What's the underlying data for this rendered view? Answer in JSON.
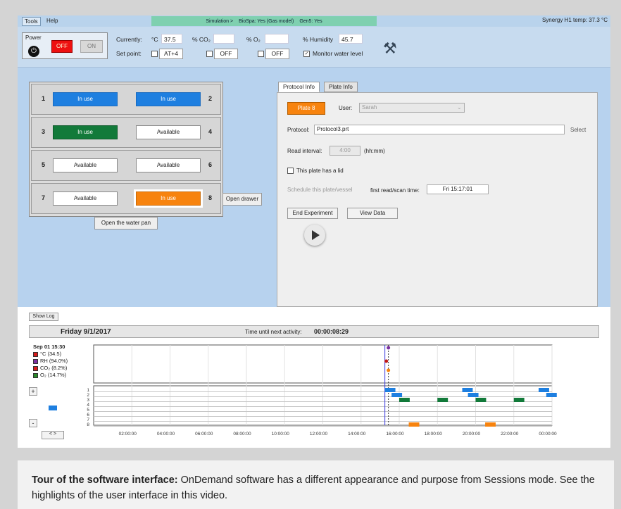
{
  "menubar": {
    "tools_label": "Tools",
    "help_label": "Help",
    "simulation": [
      "Simulation >",
      "BioSpa: Yes (Gas model)",
      "Gen5: Yes"
    ],
    "temp": "Synergy H1 temp: 37.3 °C"
  },
  "controls": {
    "power_label": "Power",
    "off_label": "OFF",
    "on_label": "ON",
    "currently_label": "Currently:",
    "setpoint_label": "Set point:",
    "temp_unit": "°C",
    "temp_value": "37.5",
    "temp_setpoint": "AT+4",
    "co2_label": "% CO₂",
    "co2_value": "",
    "co2_setpoint": "OFF",
    "o2_label": "% O₂",
    "o2_value": "",
    "o2_setpoint": "OFF",
    "humidity_label": "% Humidity",
    "humidity_value": "45.7",
    "monitor_water_label": "Monitor water level",
    "monitor_water_checked": true
  },
  "plates": {
    "slots": [
      {
        "num": "1",
        "label": "In use",
        "state": "inuse-blue"
      },
      {
        "num": "2",
        "label": "In use",
        "state": "inuse-blue"
      },
      {
        "num": "3",
        "label": "In use",
        "state": "inuse-green"
      },
      {
        "num": "4",
        "label": "Available",
        "state": "avail"
      },
      {
        "num": "5",
        "label": "Available",
        "state": "avail"
      },
      {
        "num": "6",
        "label": "Available",
        "state": "avail"
      },
      {
        "num": "7",
        "label": "Available",
        "state": "avail"
      },
      {
        "num": "8",
        "label": "In use",
        "state": "inuse-orange"
      }
    ],
    "open_drawer": "Open drawer",
    "open_water_pan": "Open the water pan"
  },
  "tabs": {
    "protocol_info": "Protocol Info",
    "plate_info": "Plate Info"
  },
  "protocol": {
    "plate_button": "Plate 8",
    "user_label": "User:",
    "user_value": "Sarah",
    "protocol_label": "Protocol:",
    "protocol_value": "Protocol3.prt",
    "select_label": "Select",
    "read_interval_label": "Read interval:",
    "read_interval_value": "4:00",
    "read_interval_unit": "(hh:mm)",
    "lid_label": "This plate has a lid",
    "schedule_label": "Schedule this plate/vessel",
    "first_read_label": "first read/scan time:",
    "first_read_value": "Fri 15:17:01",
    "end_experiment": "End Experiment",
    "view_data": "View Data"
  },
  "log": {
    "show_log": "Show Log",
    "date": "Friday 9/1/2017",
    "next_activity_label": "Time until next activity:",
    "next_activity_value": "00:00:08:29",
    "legend_time": "Sep 01 15:30",
    "legend": [
      {
        "label": "°C",
        "value": "(34.5)",
        "color": "#d81b1b"
      },
      {
        "label": "RH",
        "value": "(94.0%)",
        "color": "#7b2fa0"
      },
      {
        "label": "CO₂",
        "value": "(8.2%)",
        "color": "#d81b1b"
      },
      {
        "label": "O₂",
        "value": "(14.7%)",
        "color": "#2a8a2a"
      }
    ],
    "zoom_in": "+",
    "zoom_out": "-",
    "nav": "<  >",
    "time_ticks": [
      "02:00:00",
      "04:00:00",
      "06:00:00",
      "08:00:00",
      "10:00:00",
      "12:00:00",
      "14:00:00",
      "16:00:00",
      "18:00:00",
      "20:00:00",
      "22:00:00",
      "00:00:00"
    ],
    "row_labels": [
      "1",
      "2",
      "3",
      "4",
      "5",
      "6",
      "7",
      "8"
    ]
  },
  "colors": {
    "blue": "#1e7fe0",
    "green": "#127a3a",
    "orange": "#f7830e"
  },
  "caption": {
    "bold": "Tour of the software interface:",
    "text": " OnDemand software has a different appearance and purpose from Sessions mode. See the highlights of the user interface in this video."
  }
}
